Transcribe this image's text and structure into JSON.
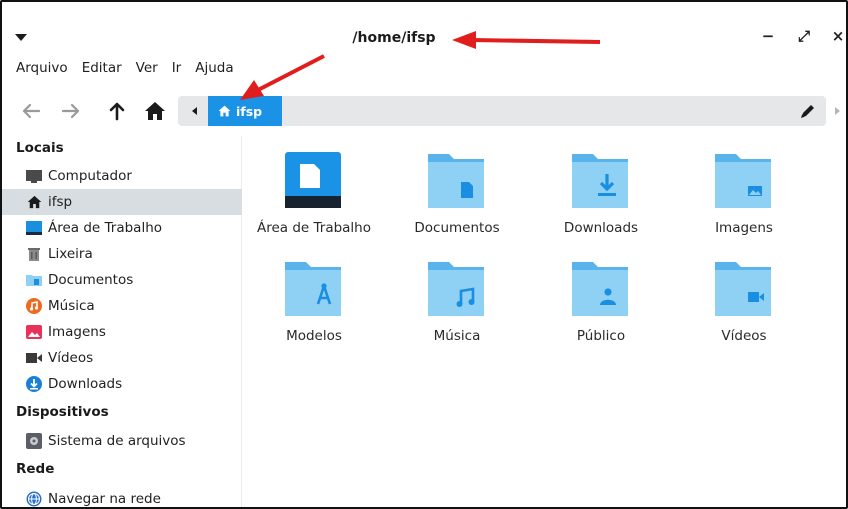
{
  "window": {
    "title": "/home/ifsp",
    "minimize_symbol": "−",
    "maximize_symbol": "⤢",
    "close_symbol": "×"
  },
  "menubar": {
    "items": [
      "Arquivo",
      "Editar",
      "Ver",
      "Ir",
      "Ajuda"
    ]
  },
  "toolbar": {
    "breadcrumb_label": "ifsp"
  },
  "sidebar": {
    "sections": [
      {
        "title": "Locais",
        "items": [
          {
            "label": "Computador",
            "icon": "monitor-icon"
          },
          {
            "label": "ifsp",
            "icon": "home-icon",
            "selected": true
          },
          {
            "label": "Área de Trabalho",
            "icon": "desktop-icon"
          },
          {
            "label": "Lixeira",
            "icon": "trash-icon"
          },
          {
            "label": "Documentos",
            "icon": "folder-documents-icon"
          },
          {
            "label": "Música",
            "icon": "music-icon"
          },
          {
            "label": "Imagens",
            "icon": "image-icon"
          },
          {
            "label": "Vídeos",
            "icon": "video-icon"
          },
          {
            "label": "Downloads",
            "icon": "download-icon"
          }
        ]
      },
      {
        "title": "Dispositivos",
        "items": [
          {
            "label": "Sistema de arquivos",
            "icon": "drive-icon"
          }
        ]
      },
      {
        "title": "Rede",
        "items": [
          {
            "label": "Navegar na rede",
            "icon": "network-icon"
          }
        ]
      }
    ]
  },
  "files": [
    {
      "label": "Área de Trabalho",
      "icon": "desktop-folder-icon"
    },
    {
      "label": "Documentos",
      "icon": "documents-folder-icon"
    },
    {
      "label": "Downloads",
      "icon": "downloads-folder-icon"
    },
    {
      "label": "Imagens",
      "icon": "pictures-folder-icon"
    },
    {
      "label": "Modelos",
      "icon": "templates-folder-icon"
    },
    {
      "label": "Música",
      "icon": "music-folder-icon"
    },
    {
      "label": "Público",
      "icon": "public-folder-icon"
    },
    {
      "label": "Vídeos",
      "icon": "videos-folder-icon"
    }
  ],
  "colors": {
    "accent": "#1a93e6",
    "folder_light": "#8fd0f5",
    "folder_tab": "#5ab4ec",
    "folder_glyph": "#1a8ee0",
    "annotation": "#e01e1e"
  }
}
